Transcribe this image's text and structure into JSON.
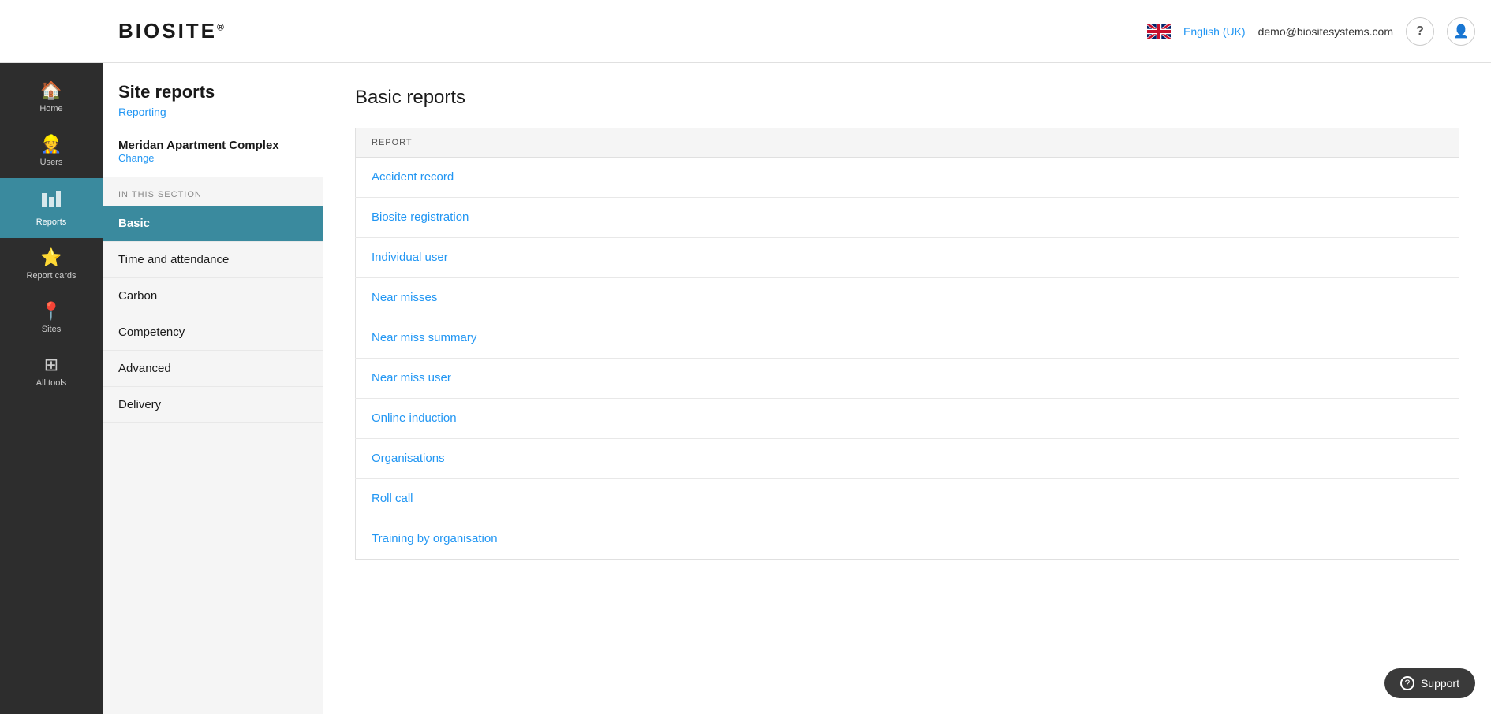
{
  "header": {
    "logo": "BIOSITE",
    "logo_reg": "®",
    "language": "English (UK)",
    "email": "demo@biositesystems.com",
    "help_icon": "?",
    "user_icon": "👤"
  },
  "sidebar": {
    "items": [
      {
        "id": "home",
        "label": "Home",
        "icon": "🏠"
      },
      {
        "id": "users",
        "label": "Users",
        "icon": "👷"
      },
      {
        "id": "reports",
        "label": "Reports",
        "icon": "📊",
        "active": true
      },
      {
        "id": "report-cards",
        "label": "Report cards",
        "icon": "⭐"
      },
      {
        "id": "sites",
        "label": "Sites",
        "icon": "📍"
      },
      {
        "id": "all-tools",
        "label": "All tools",
        "icon": "⊞"
      }
    ]
  },
  "secondary_sidebar": {
    "title": "Site reports",
    "subtitle": "Reporting",
    "site_name": "Meridan Apartment Complex",
    "change_label": "Change",
    "in_this_section_label": "IN THIS SECTION",
    "nav_items": [
      {
        "id": "basic",
        "label": "Basic",
        "active": true
      },
      {
        "id": "time-attendance",
        "label": "Time and attendance",
        "active": false
      },
      {
        "id": "carbon",
        "label": "Carbon",
        "active": false
      },
      {
        "id": "competency",
        "label": "Competency",
        "active": false
      },
      {
        "id": "advanced",
        "label": "Advanced",
        "active": false
      },
      {
        "id": "delivery",
        "label": "Delivery",
        "active": false
      }
    ]
  },
  "content": {
    "title": "Basic reports",
    "table_header": "REPORT",
    "reports": [
      {
        "id": "accident-record",
        "label": "Accident record"
      },
      {
        "id": "biosite-registration",
        "label": "Biosite registration"
      },
      {
        "id": "individual-user",
        "label": "Individual user"
      },
      {
        "id": "near-misses",
        "label": "Near misses"
      },
      {
        "id": "near-miss-summary",
        "label": "Near miss summary"
      },
      {
        "id": "near-miss-user",
        "label": "Near miss user"
      },
      {
        "id": "online-induction",
        "label": "Online induction"
      },
      {
        "id": "organisations",
        "label": "Organisations"
      },
      {
        "id": "roll-call",
        "label": "Roll call"
      },
      {
        "id": "training-by-organisation",
        "label": "Training by organisation"
      }
    ]
  },
  "support": {
    "label": "Support",
    "icon": "?"
  }
}
